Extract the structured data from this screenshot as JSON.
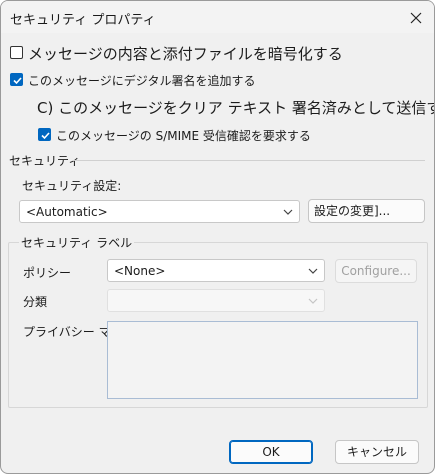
{
  "window": {
    "title": "セキュリティ プロパティ"
  },
  "options": {
    "encrypt_label": "メッセージの内容と添付ファイルを暗号化する",
    "encrypt_checked": false,
    "signature_label": "このメッセージにデジタル署名を追加する",
    "signature_checked": true,
    "clear_text_label": "C) このメッセージをクリア テキスト 署名済みとして送信する",
    "receipt_label": "このメッセージの S/MIME 受信確認を要求する",
    "receipt_checked": true
  },
  "security": {
    "section_label": "セキュリティ",
    "setting_label": "セキュリティ設定:",
    "setting_value": "<Automatic>",
    "change_settings_button": "設定の変更]..."
  },
  "security_label": {
    "group_label": "セキュリティ ラベル",
    "policy_label": "ポリシー",
    "policy_value": "<None>",
    "configure_button": "Configure...",
    "classification_label": "分類",
    "classification_value": "",
    "privacy_mark_label": "プライバシー マーク:",
    "privacy_mark_value": ""
  },
  "footer": {
    "ok_button": "OK",
    "cancel_button": "キャンセル"
  },
  "colors": {
    "accent": "#0067c0",
    "window_bg": "#f0f0f0"
  }
}
